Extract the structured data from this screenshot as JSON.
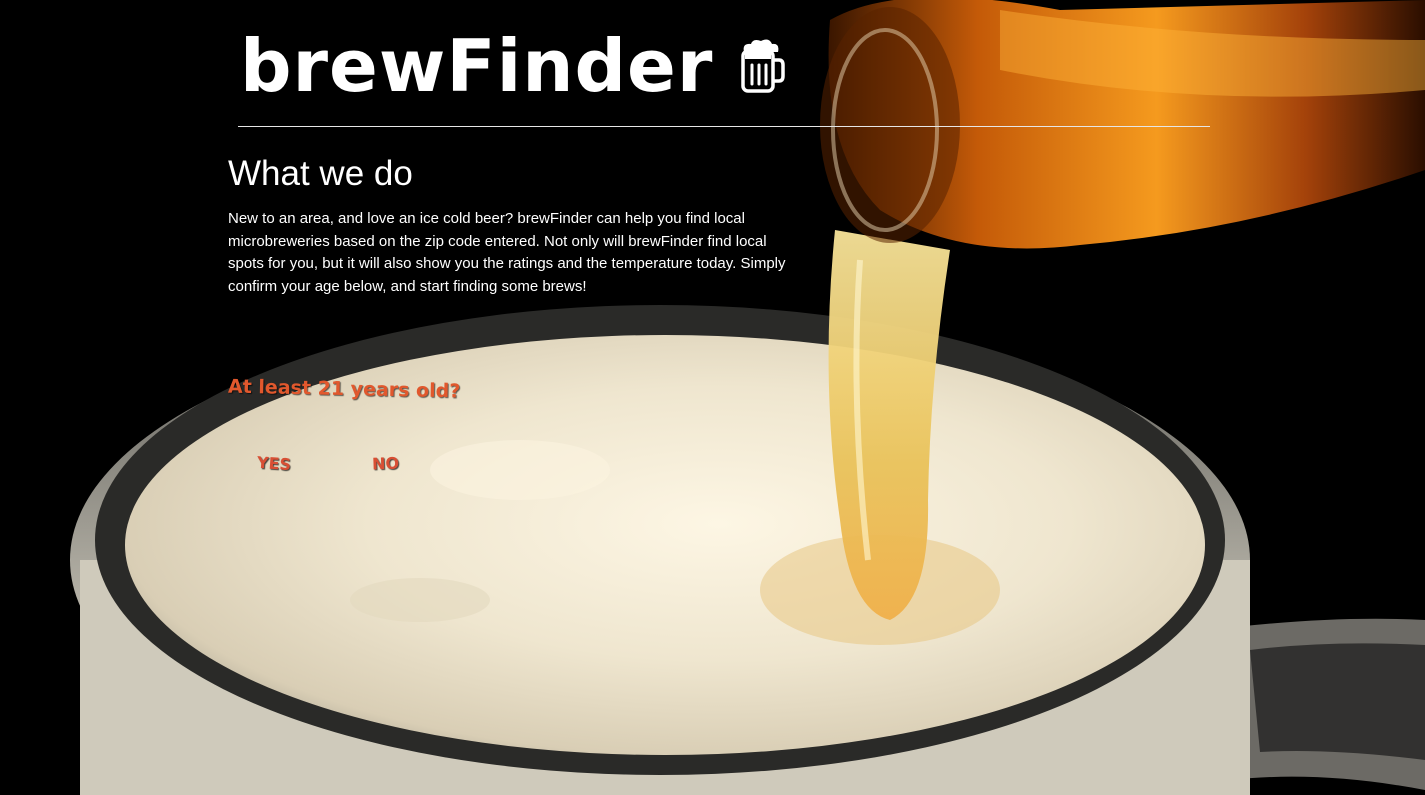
{
  "header": {
    "title": "brewFinder",
    "icon": "beer-mug-icon"
  },
  "about": {
    "heading": "What we do",
    "description": "New to an area, and love an ice cold beer? brewFinder can help you find local microbreweries based on the zip code entered. Not only will brewFinder find local spots for you, but it will also show you the ratings and the temperature today. Simply confirm your age below, and start finding some brews!"
  },
  "age_check": {
    "question": "At least 21 years old?",
    "yes_label": "YES",
    "no_label": "NO"
  },
  "colors": {
    "background": "#000000",
    "text": "#ffffff",
    "accent": "#e1582d"
  }
}
